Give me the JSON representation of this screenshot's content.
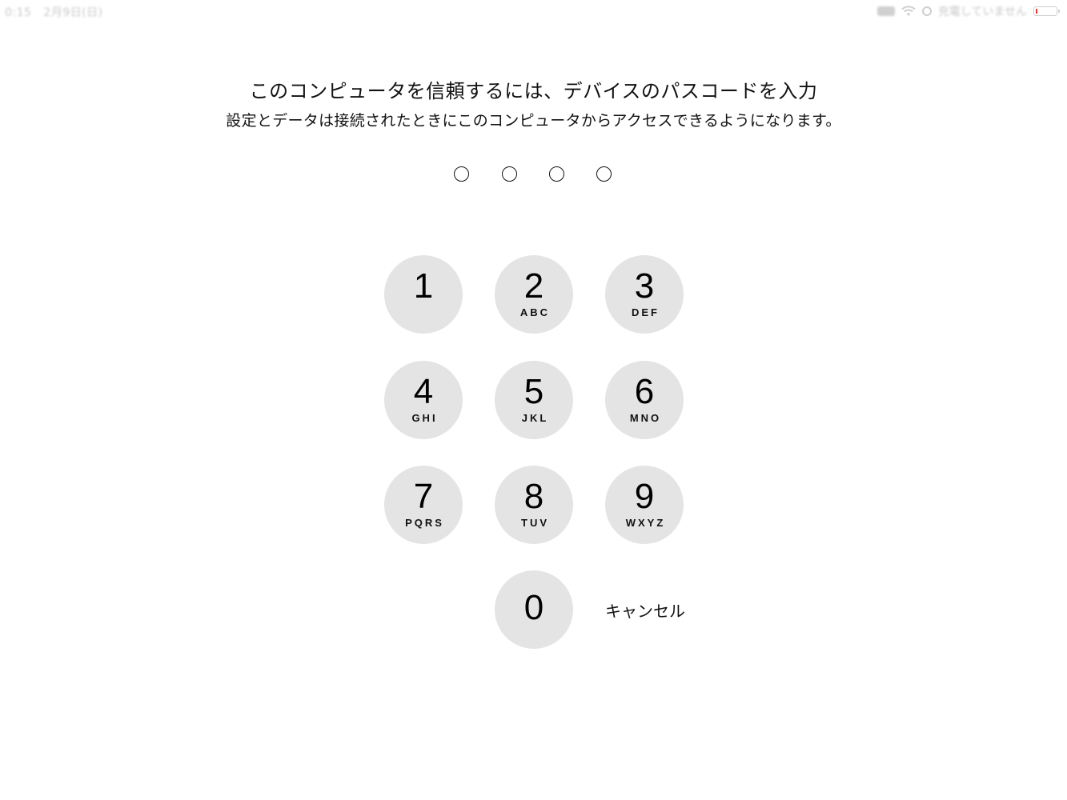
{
  "status_bar": {
    "time": "0:15",
    "date": "2月9日(日)",
    "charging_text": "充電していません",
    "battery_color": "#e63a2e"
  },
  "prompt": {
    "title": "このコンピュータを信頼するには、デバイスのパスコードを入力",
    "subtitle": "設定とデータは接続されたときにこのコンピュータからアクセスできるようになります。"
  },
  "passcode": {
    "length": 4,
    "entered": 0
  },
  "keypad": {
    "key_color": "#e4e4e4",
    "keys": [
      {
        "digit": "1",
        "letters": ""
      },
      {
        "digit": "2",
        "letters": "ABC"
      },
      {
        "digit": "3",
        "letters": "DEF"
      },
      {
        "digit": "4",
        "letters": "GHI"
      },
      {
        "digit": "5",
        "letters": "JKL"
      },
      {
        "digit": "6",
        "letters": "MNO"
      },
      {
        "digit": "7",
        "letters": "PQRS"
      },
      {
        "digit": "8",
        "letters": "TUV"
      },
      {
        "digit": "9",
        "letters": "WXYZ"
      },
      {
        "digit": "0",
        "letters": ""
      }
    ],
    "cancel_label": "キャンセル"
  }
}
